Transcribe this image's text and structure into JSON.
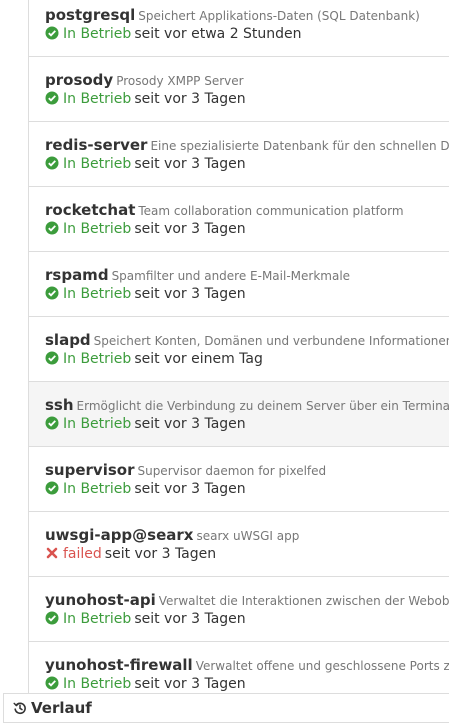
{
  "services": [
    {
      "name": "postgresql",
      "description": "Speichert Applikations-Daten (SQL Datenbank)",
      "status": "In Betrieb",
      "status_kind": "ok",
      "since": "seit vor etwa 2 Stunden"
    },
    {
      "name": "prosody",
      "description": "Prosody XMPP Server",
      "status": "In Betrieb",
      "status_kind": "ok",
      "since": "seit vor 3 Tagen"
    },
    {
      "name": "redis-server",
      "description": "Eine spezialisierte Datenbank für den schnellen Datenz",
      "status": "In Betrieb",
      "status_kind": "ok",
      "since": "seit vor 3 Tagen"
    },
    {
      "name": "rocketchat",
      "description": "Team collaboration communication platform",
      "status": "In Betrieb",
      "status_kind": "ok",
      "since": "seit vor 3 Tagen"
    },
    {
      "name": "rspamd",
      "description": "Spamfilter und andere E-Mail-Merkmale",
      "status": "In Betrieb",
      "status_kind": "ok",
      "since": "seit vor 3 Tagen"
    },
    {
      "name": "slapd",
      "description": "Speichert Konten, Domänen und verbundene Informationen",
      "status": "In Betrieb",
      "status_kind": "ok",
      "since": "seit vor einem Tag"
    },
    {
      "name": "ssh",
      "description": "Ermöglicht die Verbindung zu deinem Server über ein Terminal (SS",
      "status": "In Betrieb",
      "status_kind": "ok",
      "since": "seit vor 3 Tagen"
    },
    {
      "name": "supervisor",
      "description": "Supervisor daemon for pixelfed",
      "status": "In Betrieb",
      "status_kind": "ok",
      "since": "seit vor 3 Tagen"
    },
    {
      "name": "uwsgi-app@searx",
      "description": "searx uWSGI app",
      "status": "failed",
      "status_kind": "failed",
      "since": "seit vor 3 Tagen"
    },
    {
      "name": "yunohost-api",
      "description": "Verwaltet die Interaktionen zwischen der Weboberfläc",
      "status": "In Betrieb",
      "status_kind": "ok",
      "since": "seit vor 3 Tagen"
    },
    {
      "name": "yunohost-firewall",
      "description": "Verwaltet offene und geschlossene Ports zur Ver",
      "status": "In Betrieb",
      "status_kind": "ok",
      "since": "seit vor 3 Tagen"
    }
  ],
  "footer": {
    "history_label": "Verlauf",
    "history_icon": "history-icon"
  },
  "colors": {
    "ok": "#3c9c3c",
    "failed": "#d9534f"
  }
}
